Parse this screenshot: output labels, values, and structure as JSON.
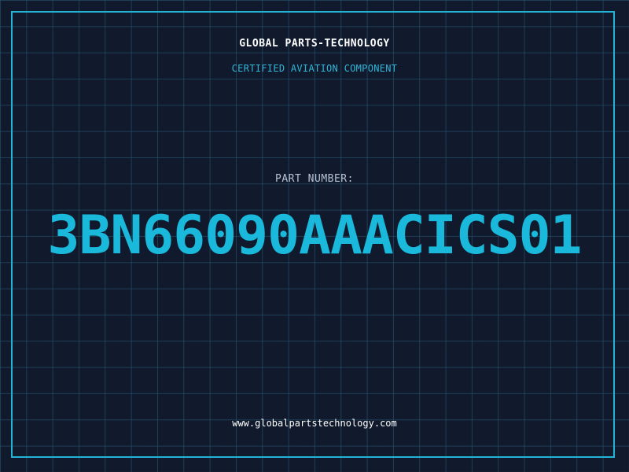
{
  "header": {
    "company": "GLOBAL PARTS-TECHNOLOGY",
    "tagline": "CERTIFIED AVIATION COMPONENT"
  },
  "part": {
    "label": "PART NUMBER:",
    "number": "3BN66090AAACICS01"
  },
  "footer": {
    "website": "www.globalpartstechnology.com"
  },
  "colors": {
    "background": "#101a2c",
    "grid": "#2a5c7a",
    "accent": "#1ab9dc",
    "frame": "#22b3d6",
    "text": "#ffffff"
  }
}
